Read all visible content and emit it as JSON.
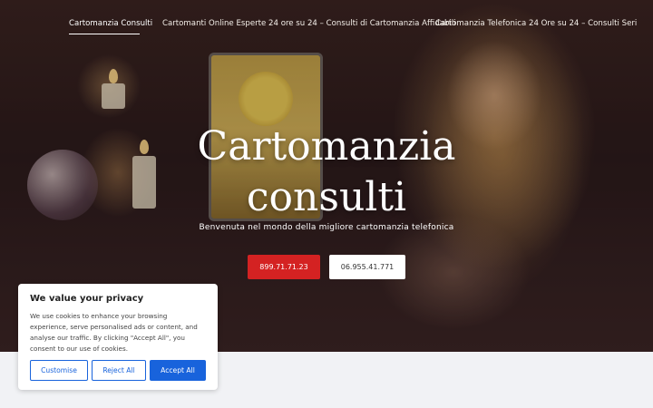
{
  "nav": {
    "items": [
      {
        "label": "Cartomanzia Consulti",
        "active": true
      },
      {
        "label": "Cartomanti Online Esperte 24 ore su 24 – Consulti di Cartomanzia Affidabili",
        "active": false
      },
      {
        "label": "Cartomanzia Telefonica 24 Ore su 24 – Consulti Seri",
        "active": false
      }
    ]
  },
  "hero": {
    "title_line1": "Cartomanzia",
    "title_line2": "consulti",
    "subtitle": "Benvenuta nel mondo della migliore cartomanzia telefonica",
    "buttons": {
      "primary_label": "899.71.71.23",
      "secondary_label": "06.955.41.771"
    },
    "image_alt": "Cartomante con carte dei tarocchi e candele"
  },
  "cookie_banner": {
    "title": "We value your privacy",
    "text": "We use cookies to enhance your browsing experience, serve personalised ads or content, and analyse our traffic. By clicking \"Accept All\", you consent to our use of cookies.",
    "customise_label": "Customise",
    "reject_label": "Reject All",
    "accept_label": "Accept All"
  },
  "colors": {
    "primary_button": "#d42222",
    "cookie_accent": "#1863dc",
    "page_background": "#f1f2f5"
  }
}
